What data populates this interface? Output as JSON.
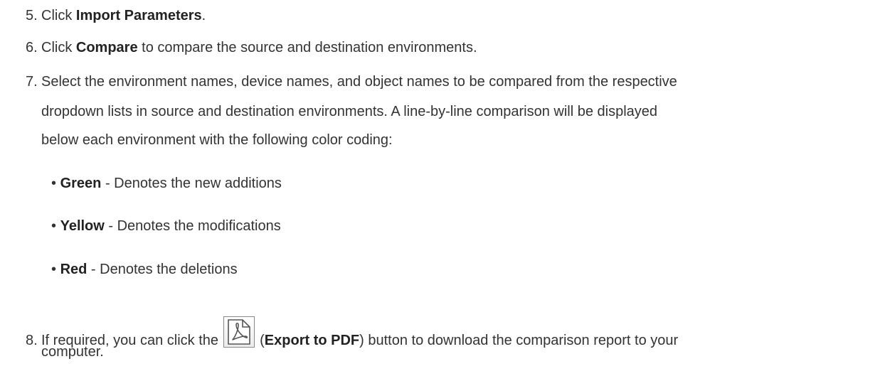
{
  "steps": [
    {
      "number": "5.",
      "pre": "Click ",
      "bold": "Import Parameters",
      "post": "."
    },
    {
      "number": "6.",
      "pre": "Click ",
      "bold": "Compare",
      "post": " to compare the source and destination environments."
    },
    {
      "number": "7.",
      "lines": [
        "Select the environment names, device names, and object names to be compared from the respective",
        "dropdown lists in source and destination environments. A line-by-line comparison will be displayed",
        "below each environment with the following color coding:"
      ],
      "bullets": [
        {
          "marker": "•",
          "bold": "Green",
          "text": " - Denotes the new additions"
        },
        {
          "marker": "•",
          "bold": "Yellow",
          "text": " - Denotes the modifications"
        },
        {
          "marker": "•",
          "bold": "Red",
          "text": " - Denotes the deletions"
        }
      ]
    },
    {
      "number": "8.",
      "pre": "If required, you can click the ",
      "icon": "export-to-pdf-icon",
      "paren_open": " (",
      "bold": "Export to PDF",
      "post": ") button to download the comparison report to your",
      "continuation": "computer."
    }
  ]
}
